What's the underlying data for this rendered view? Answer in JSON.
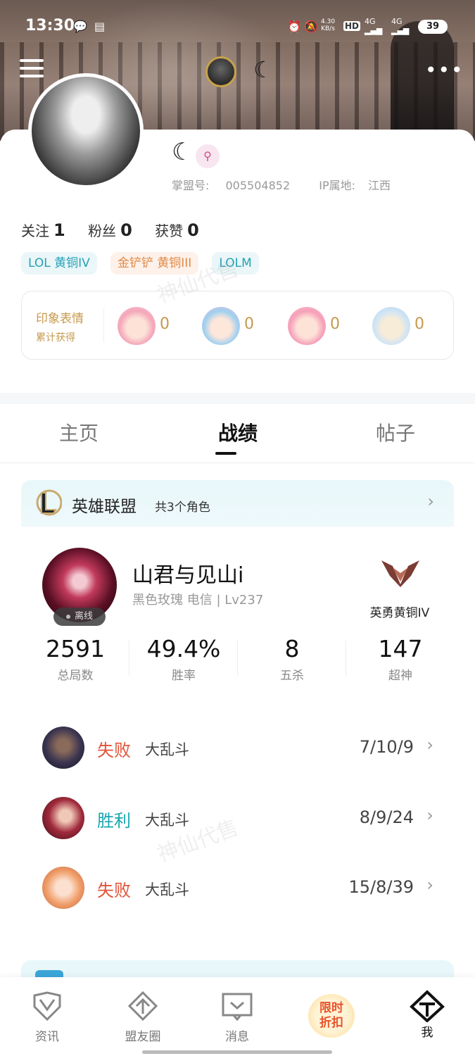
{
  "status_bar": {
    "time": "13:30",
    "speed_value": "4.30",
    "speed_unit": "KB/s",
    "net1": "4G",
    "net2": "4G",
    "hd": "HD",
    "battery": "39"
  },
  "profile": {
    "nickname_glyph": "☾",
    "id_label": "掌盟号:",
    "id_value": "005504852",
    "ip_label": "IP属地:",
    "ip_value": "江西",
    "stats": {
      "following_label": "关注",
      "following": "1",
      "fans_label": "粉丝",
      "fans": "0",
      "likes_label": "获赞",
      "likes": "0"
    },
    "tags": [
      "LOL 黄铜IV",
      "金铲铲 黄铜III",
      "LOLM"
    ],
    "impression": {
      "title": "印象表情",
      "subtitle": "累计获得",
      "counts": [
        "0",
        "0",
        "0",
        "0"
      ]
    }
  },
  "tabs": [
    "主页",
    "战绩",
    "帖子"
  ],
  "active_tab": "战绩",
  "game": {
    "title": "英雄联盟",
    "count": "共3个角色"
  },
  "summoner": {
    "name": "山君与见山i",
    "subtitle": "黑色玫瑰 电信 | Lv237",
    "status": "离线",
    "rank": "英勇黄铜IV"
  },
  "kpis": [
    {
      "value": "2591",
      "label": "总局数"
    },
    {
      "value": "49.4%",
      "label": "胜率"
    },
    {
      "value": "8",
      "label": "五杀"
    },
    {
      "value": "147",
      "label": "超神"
    }
  ],
  "matches": [
    {
      "result": "失败",
      "outcome": "lose",
      "mode": "大乱斗",
      "kda": "7/10/9"
    },
    {
      "result": "胜利",
      "outcome": "win",
      "mode": "大乱斗",
      "kda": "8/9/24"
    },
    {
      "result": "失败",
      "outcome": "lose",
      "mode": "大乱斗",
      "kda": "15/8/39"
    }
  ],
  "bottom_nav": {
    "news": "资讯",
    "friends": "盟友圈",
    "messages": "消息",
    "promo_line1": "限时",
    "promo_line2": "折扣",
    "me": "我"
  },
  "watermark": "神仙代售",
  "colors": {
    "lose": "#e2533a",
    "win": "#1aa6b0",
    "accent_gold": "#c59a4e",
    "tag_teal": "#27a1b5"
  }
}
